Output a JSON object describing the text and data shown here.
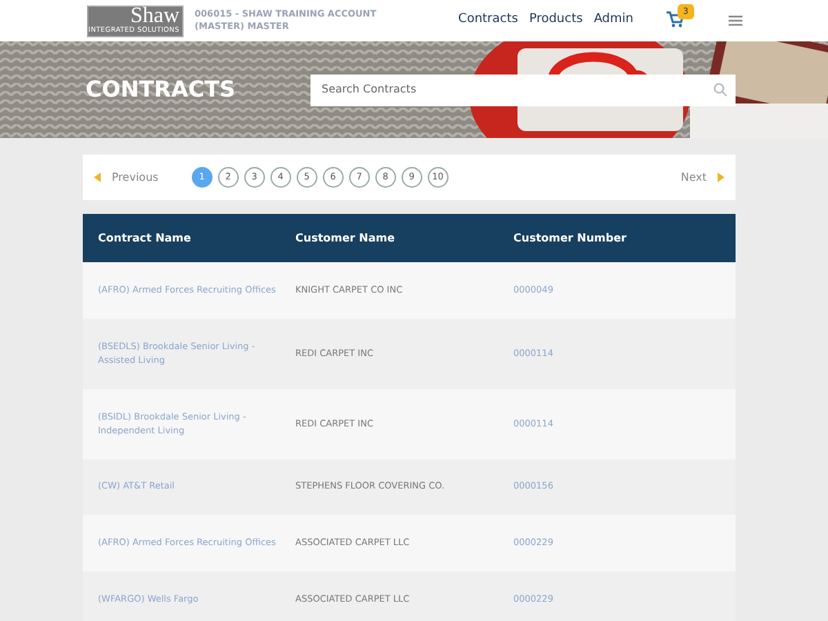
{
  "header": {
    "logo": {
      "name": "Shaw",
      "tagline": "INTEGRATED SOLUTIONS"
    },
    "account": "006015 - SHAW TRAINING ACCOUNT (MASTER) MASTER",
    "nav": [
      "Contracts",
      "Products",
      "Admin"
    ],
    "cart_count": "3"
  },
  "banner": {
    "title": "CONTRACTS",
    "search": {
      "placeholder": "Search Contracts"
    }
  },
  "pagination": {
    "previous": "Previous",
    "next": "Next",
    "pages": [
      {
        "label": "1",
        "selected": true
      },
      {
        "label": "2",
        "selected": false
      },
      {
        "label": "3",
        "selected": false
      },
      {
        "label": "4",
        "selected": false
      },
      {
        "label": "5",
        "selected": false
      },
      {
        "label": "6",
        "selected": false
      },
      {
        "label": "7",
        "selected": false
      },
      {
        "label": "8",
        "selected": false
      },
      {
        "label": "9",
        "selected": false
      },
      {
        "label": "10",
        "selected": false
      }
    ]
  },
  "table": {
    "columns": [
      "Contract Name",
      "Customer Name",
      "Customer Number"
    ],
    "rows": [
      {
        "contract": "(AFRO) Armed Forces Recruiting Offices",
        "customer": "KNIGHT CARPET CO INC",
        "number": "0000049"
      },
      {
        "contract": "(BSEDLS) Brookdale Senior Living - Assisted Living",
        "customer": "REDI CARPET INC",
        "number": "0000114"
      },
      {
        "contract": "(BSIDL) Brookdale Senior Living - Independent Living",
        "customer": "REDI CARPET INC",
        "number": "0000114"
      },
      {
        "contract": "(CW) AT&T Retail",
        "customer": "STEPHENS FLOOR COVERING CO.",
        "number": "0000156"
      },
      {
        "contract": "(AFRO) Armed Forces Recruiting Offices",
        "customer": "ASSOCIATED CARPET LLC",
        "number": "0000229"
      },
      {
        "contract": "(WFARGO) Wells Fargo",
        "customer": "ASSOCIATED CARPET LLC",
        "number": "0000229"
      }
    ]
  }
}
